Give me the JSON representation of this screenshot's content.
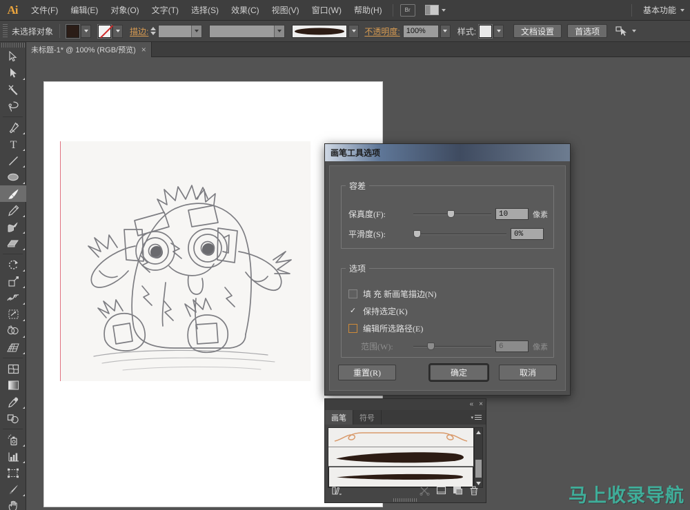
{
  "app": {
    "logo": "Ai",
    "workspace_label": "基本功能"
  },
  "menubar": {
    "items": [
      {
        "label": "文件(F)"
      },
      {
        "label": "编辑(E)"
      },
      {
        "label": "对象(O)"
      },
      {
        "label": "文字(T)"
      },
      {
        "label": "选择(S)"
      },
      {
        "label": "效果(C)"
      },
      {
        "label": "视图(V)"
      },
      {
        "label": "窗口(W)"
      },
      {
        "label": "帮助(H)"
      }
    ],
    "bridge_icon": "Br",
    "arrange_icon": "arrange-documents-icon"
  },
  "controlbar": {
    "selection_status": "未选择对象",
    "fill_color": "#2b1d17",
    "stroke_label": "描边:",
    "stroke_weight": "",
    "stroke_profile": "",
    "brush_definition": "basic-oval-brush",
    "opacity_label": "不透明度:",
    "opacity_value": "100%",
    "style_label": "样式:",
    "document_setup_button": "文档设置",
    "preferences_button": "首选项",
    "select_similar_icon": "select-similar-objects-icon"
  },
  "document": {
    "tab_title": "未标题-1* @ 100% (RGB/预览)",
    "close_icon": "×"
  },
  "toolbar": {
    "groups": [
      {
        "tools": [
          {
            "name": "selection-tool",
            "icon": "arrow-solid",
            "active": false,
            "has_flyout": false
          },
          {
            "name": "direct-selection-tool",
            "icon": "arrow-white",
            "active": false,
            "has_flyout": true
          },
          {
            "name": "magic-wand-tool",
            "icon": "magic-wand",
            "active": false,
            "has_flyout": false
          },
          {
            "name": "lasso-tool",
            "icon": "lasso",
            "active": false,
            "has_flyout": false
          }
        ]
      },
      {
        "tools": [
          {
            "name": "pen-tool",
            "icon": "pen",
            "active": false,
            "has_flyout": true
          },
          {
            "name": "type-tool",
            "icon": "type-T",
            "active": false,
            "has_flyout": true
          },
          {
            "name": "line-segment-tool",
            "icon": "line",
            "active": false,
            "has_flyout": true
          },
          {
            "name": "ellipse-tool",
            "icon": "ellipse",
            "active": false,
            "has_flyout": true
          },
          {
            "name": "paintbrush-tool",
            "icon": "paintbrush",
            "active": true,
            "has_flyout": false
          },
          {
            "name": "pencil-tool",
            "icon": "pencil",
            "active": false,
            "has_flyout": true
          },
          {
            "name": "blob-brush-tool",
            "icon": "blob-brush",
            "active": false,
            "has_flyout": false
          },
          {
            "name": "eraser-tool",
            "icon": "eraser",
            "active": false,
            "has_flyout": true
          }
        ]
      },
      {
        "tools": [
          {
            "name": "rotate-tool",
            "icon": "rotate",
            "active": false,
            "has_flyout": true
          },
          {
            "name": "scale-tool",
            "icon": "scale",
            "active": false,
            "has_flyout": true
          },
          {
            "name": "width-warp-tool",
            "icon": "warp",
            "active": false,
            "has_flyout": true
          },
          {
            "name": "free-transform-tool",
            "icon": "free-transform",
            "active": false,
            "has_flyout": false
          },
          {
            "name": "shape-builder-tool",
            "icon": "shape-builder",
            "active": false,
            "has_flyout": true
          },
          {
            "name": "perspective-grid-tool",
            "icon": "perspective-grid",
            "active": false,
            "has_flyout": true
          }
        ]
      },
      {
        "tools": [
          {
            "name": "mesh-tool",
            "icon": "mesh",
            "active": false,
            "has_flyout": false
          },
          {
            "name": "gradient-tool",
            "icon": "gradient",
            "active": false,
            "has_flyout": false
          },
          {
            "name": "eyedropper-tool",
            "icon": "eyedropper",
            "active": false,
            "has_flyout": true
          },
          {
            "name": "blend-tool",
            "icon": "blend",
            "active": false,
            "has_flyout": true
          }
        ]
      },
      {
        "tools": [
          {
            "name": "symbol-sprayer-tool",
            "icon": "symbol-sprayer",
            "active": false,
            "has_flyout": true
          },
          {
            "name": "column-graph-tool",
            "icon": "column-graph",
            "active": false,
            "has_flyout": true
          },
          {
            "name": "artboard-tool",
            "icon": "artboard",
            "active": false,
            "has_flyout": false
          },
          {
            "name": "slice-tool",
            "icon": "slice",
            "active": false,
            "has_flyout": true
          },
          {
            "name": "hand-tool",
            "icon": "hand",
            "active": false,
            "has_flyout": true
          }
        ]
      }
    ]
  },
  "dialog": {
    "title": "画笔工具选项",
    "tolerance_group": {
      "legend": "容差",
      "fidelity": {
        "label": "保真度(F):",
        "value": "10",
        "unit": "像素",
        "slider_percent": 43
      },
      "smoothness": {
        "label": "平滑度(S):",
        "value": "0%",
        "unit": "",
        "slider_percent": 0
      }
    },
    "options_group": {
      "legend": "选项",
      "checkboxes": [
        {
          "label": "填 充 新画笔描边(N)",
          "checked": false,
          "focused": false
        },
        {
          "label": "保持选定(K)",
          "checked": true,
          "focused": false
        },
        {
          "label": "编辑所选路径(E)",
          "checked": false,
          "focused": true
        }
      ],
      "range": {
        "label": "范围(W):",
        "value": "6",
        "unit": "像素",
        "slider_percent": 18,
        "disabled": true
      }
    },
    "buttons": {
      "reset": "重置(R)",
      "ok": "确定",
      "cancel": "取消"
    }
  },
  "brushes_panel": {
    "collapse_icon": "«",
    "close_icon": "×",
    "tabs": [
      {
        "label": "画笔",
        "active": true
      },
      {
        "label": "符号",
        "active": false
      }
    ],
    "menu_icon": "panel-menu-icon",
    "brushes": [
      {
        "name": "orange-loop-brush",
        "type": "art",
        "color": "#d99a6b",
        "selected": false
      },
      {
        "name": "thick-tapered-brush",
        "type": "calligraphic",
        "color": "#2d1c14",
        "selected": false
      },
      {
        "name": "thin-tapered-brush",
        "type": "calligraphic",
        "color": "#2d1c14",
        "selected": true
      }
    ],
    "footer_icons": [
      {
        "name": "brush-libraries-menu-icon",
        "disabled": false
      },
      {
        "name": "remove-brush-stroke-icon",
        "disabled": true
      },
      {
        "name": "options-of-selected-object-icon",
        "disabled": false
      },
      {
        "name": "new-brush-icon",
        "disabled": false
      },
      {
        "name": "delete-brush-icon",
        "disabled": false
      }
    ]
  },
  "watermark": {
    "text": "马上收录导航",
    "color": "#3fae9a"
  }
}
